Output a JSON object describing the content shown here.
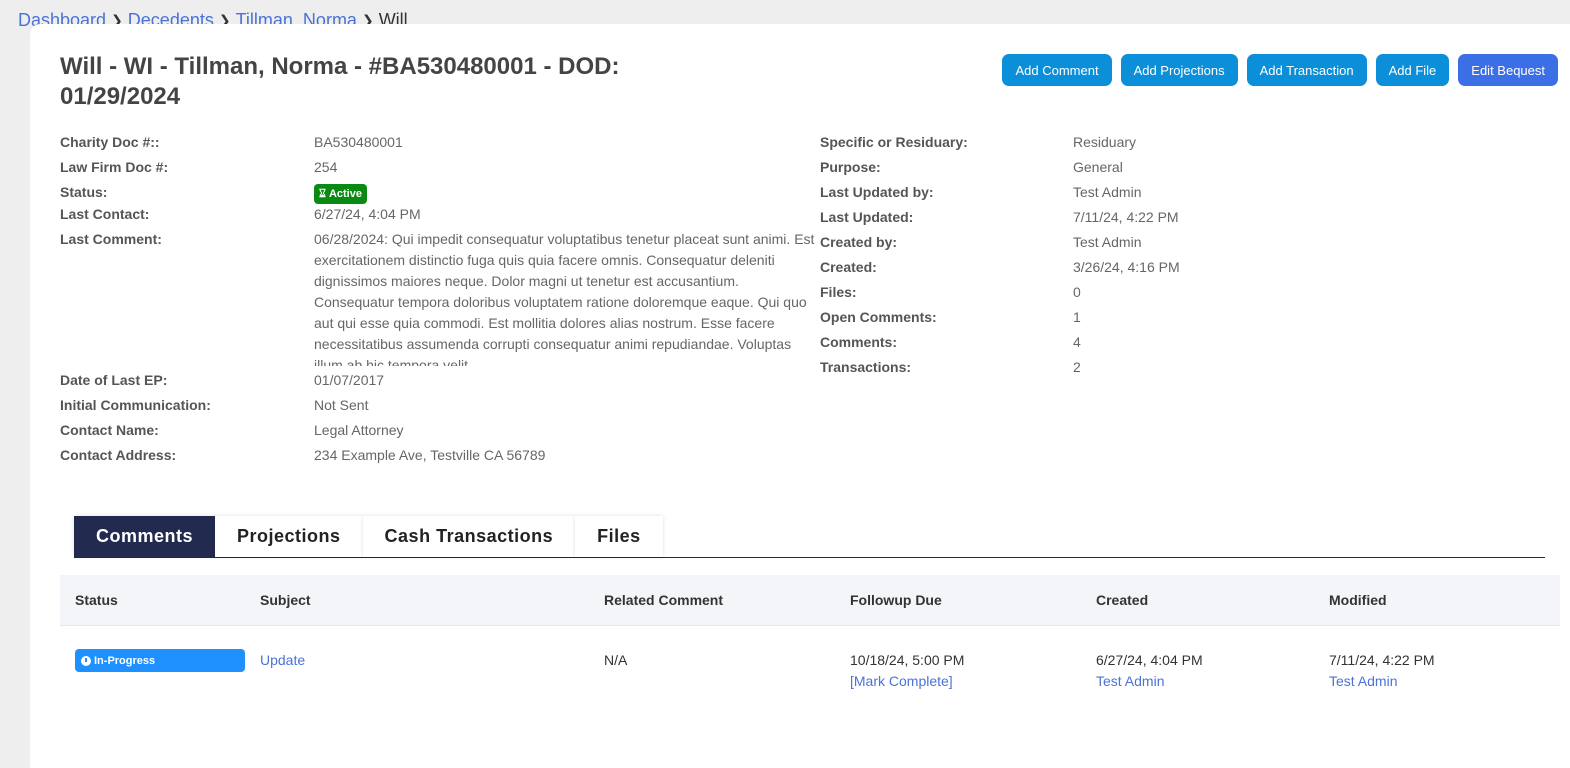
{
  "breadcrumb": {
    "items": [
      "Dashboard",
      "Decedents",
      "Tillman, Norma"
    ],
    "current": "Will"
  },
  "page": {
    "title": "Will - WI - Tillman, Norma - #BA530480001 - DOD: 01/29/2024"
  },
  "actions": {
    "add_comment": "Add Comment",
    "add_projections": "Add Projections",
    "add_transaction": "Add Transaction",
    "add_file": "Add File",
    "edit_bequest": "Edit Bequest"
  },
  "details": {
    "charity_doc_label": "Charity Doc #::",
    "charity_doc": "BA530480001",
    "law_firm_doc_label": "Law Firm Doc #:",
    "law_firm_doc": "254",
    "status_label": "Status:",
    "status": "Active",
    "last_contact_label": "Last Contact:",
    "last_contact": "6/27/24, 4:04 PM",
    "last_comment_label": "Last Comment:",
    "last_comment": "06/28/2024: Qui impedit consequatur voluptatibus tenetur placeat sunt animi. Est exercitationem distinctio fuga quis quia facere omnis. Consequatur deleniti dignissimos maiores neque. Dolor magni ut tenetur est accusantium. Consequatur tempora doloribus voluptatem ratione doloremque eaque. Qui quo aut qui esse quia commodi. Est mollitia dolores alias nostrum. Esse facere necessitatibus assumenda corrupti consequatur animi repudiandae. Voluptas illum ab hic tempora velit",
    "date_last_ep_label": "Date of Last EP:",
    "date_last_ep": "01/07/2017",
    "initial_comm_label": "Initial Communication:",
    "initial_comm": "Not Sent",
    "contact_name_label": "Contact Name:",
    "contact_name": "Legal Attorney",
    "contact_address_label": "Contact Address:",
    "contact_address": "234 Example Ave, Testville CA 56789"
  },
  "details_right": {
    "specific_label": "Specific or Residuary:",
    "specific": "Residuary",
    "purpose_label": "Purpose:",
    "purpose": "General",
    "last_updated_by_label": "Last Updated by:",
    "last_updated_by": "Test Admin",
    "last_updated_label": "Last Updated:",
    "last_updated": "7/11/24, 4:22 PM",
    "created_by_label": "Created by:",
    "created_by": "Test Admin",
    "created_label": "Created:",
    "created": "3/26/24, 4:16 PM",
    "files_label": "Files:",
    "files": "0",
    "open_comments_label": "Open Comments:",
    "open_comments": "1",
    "comments_label": "Comments:",
    "comments": "4",
    "transactions_label": "Transactions:",
    "transactions": "2"
  },
  "tabs": [
    "Comments",
    "Projections",
    "Cash Transactions",
    "Files"
  ],
  "table": {
    "headers": [
      "Status",
      "Subject",
      "Related Comment",
      "Followup Due",
      "Created",
      "Modified"
    ],
    "rows": [
      {
        "status": "In-Progress",
        "subject": "Update",
        "related": "N/A",
        "followup": "10/18/24, 5:00 PM",
        "mark_complete": "[Mark Complete]",
        "created": "6/27/24, 4:04 PM",
        "created_by": "Test Admin",
        "modified": "7/11/24, 4:22 PM",
        "modified_by": "Test Admin"
      }
    ]
  },
  "colors": {
    "primary_button": "#0b8fd8",
    "secondary_button": "#3c6fe6",
    "active_tab": "#222a50",
    "status_active": "#0a8a12",
    "status_progress": "#1e90ff",
    "link": "#4a72d8"
  }
}
